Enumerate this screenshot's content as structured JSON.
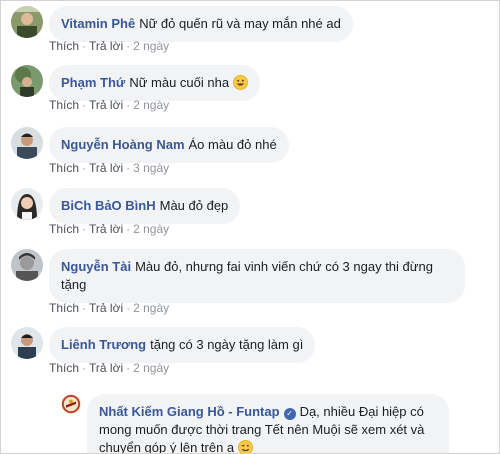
{
  "comments": [
    {
      "name": "Vitamin Phê",
      "text": "Nữ đỏ quến rũ và may mắn nhé ad",
      "like": "Thích",
      "reply": "Trả lời",
      "time": "2 ngày"
    },
    {
      "name": "Phạm Thứ",
      "text": "Nữ màu cuối nha",
      "emoji": "smiling-face-emoji",
      "like": "Thích",
      "reply": "Trả lời",
      "time": "2 ngày"
    },
    {
      "name": "Nguyễn Hoàng Nam",
      "text": "Áo màu đỏ nhé",
      "like": "Thích",
      "reply": "Trả lời",
      "time": "3 ngày"
    },
    {
      "name": "BiCh BảO BìnH",
      "text": "Màu đỏ đẹp",
      "like": "Thích",
      "reply": "Trả lời",
      "time": "2 ngày"
    },
    {
      "name": "Nguyễn Tài",
      "text": "Màu đỏ, nhưng fai vinh viến chứ có 3 ngay thi đừng tặng",
      "like": "Thích",
      "reply": "Trả lời",
      "time": "2 ngày"
    },
    {
      "name": "Liênh Trương",
      "text": "tặng có 3 ngày tặng làm gì",
      "like": "Thích",
      "reply": "Trả lời",
      "time": "2 ngày"
    }
  ],
  "reply": {
    "name": "Nhất Kiếm Giang Hồ - Funtap",
    "verified_icon": "verified-badge-icon",
    "text": "Dạ, nhiều Đại hiệp có mong muốn được thời trang Tết nên Muội sẽ xem xét và chuyển góp ý lên trên a",
    "emoji": "winking-face-emoji"
  },
  "separator": "·",
  "colors": {
    "name": "#385898",
    "bubble": "#f2f3f5",
    "meta": "#90949c",
    "verified": "#4267b2"
  }
}
